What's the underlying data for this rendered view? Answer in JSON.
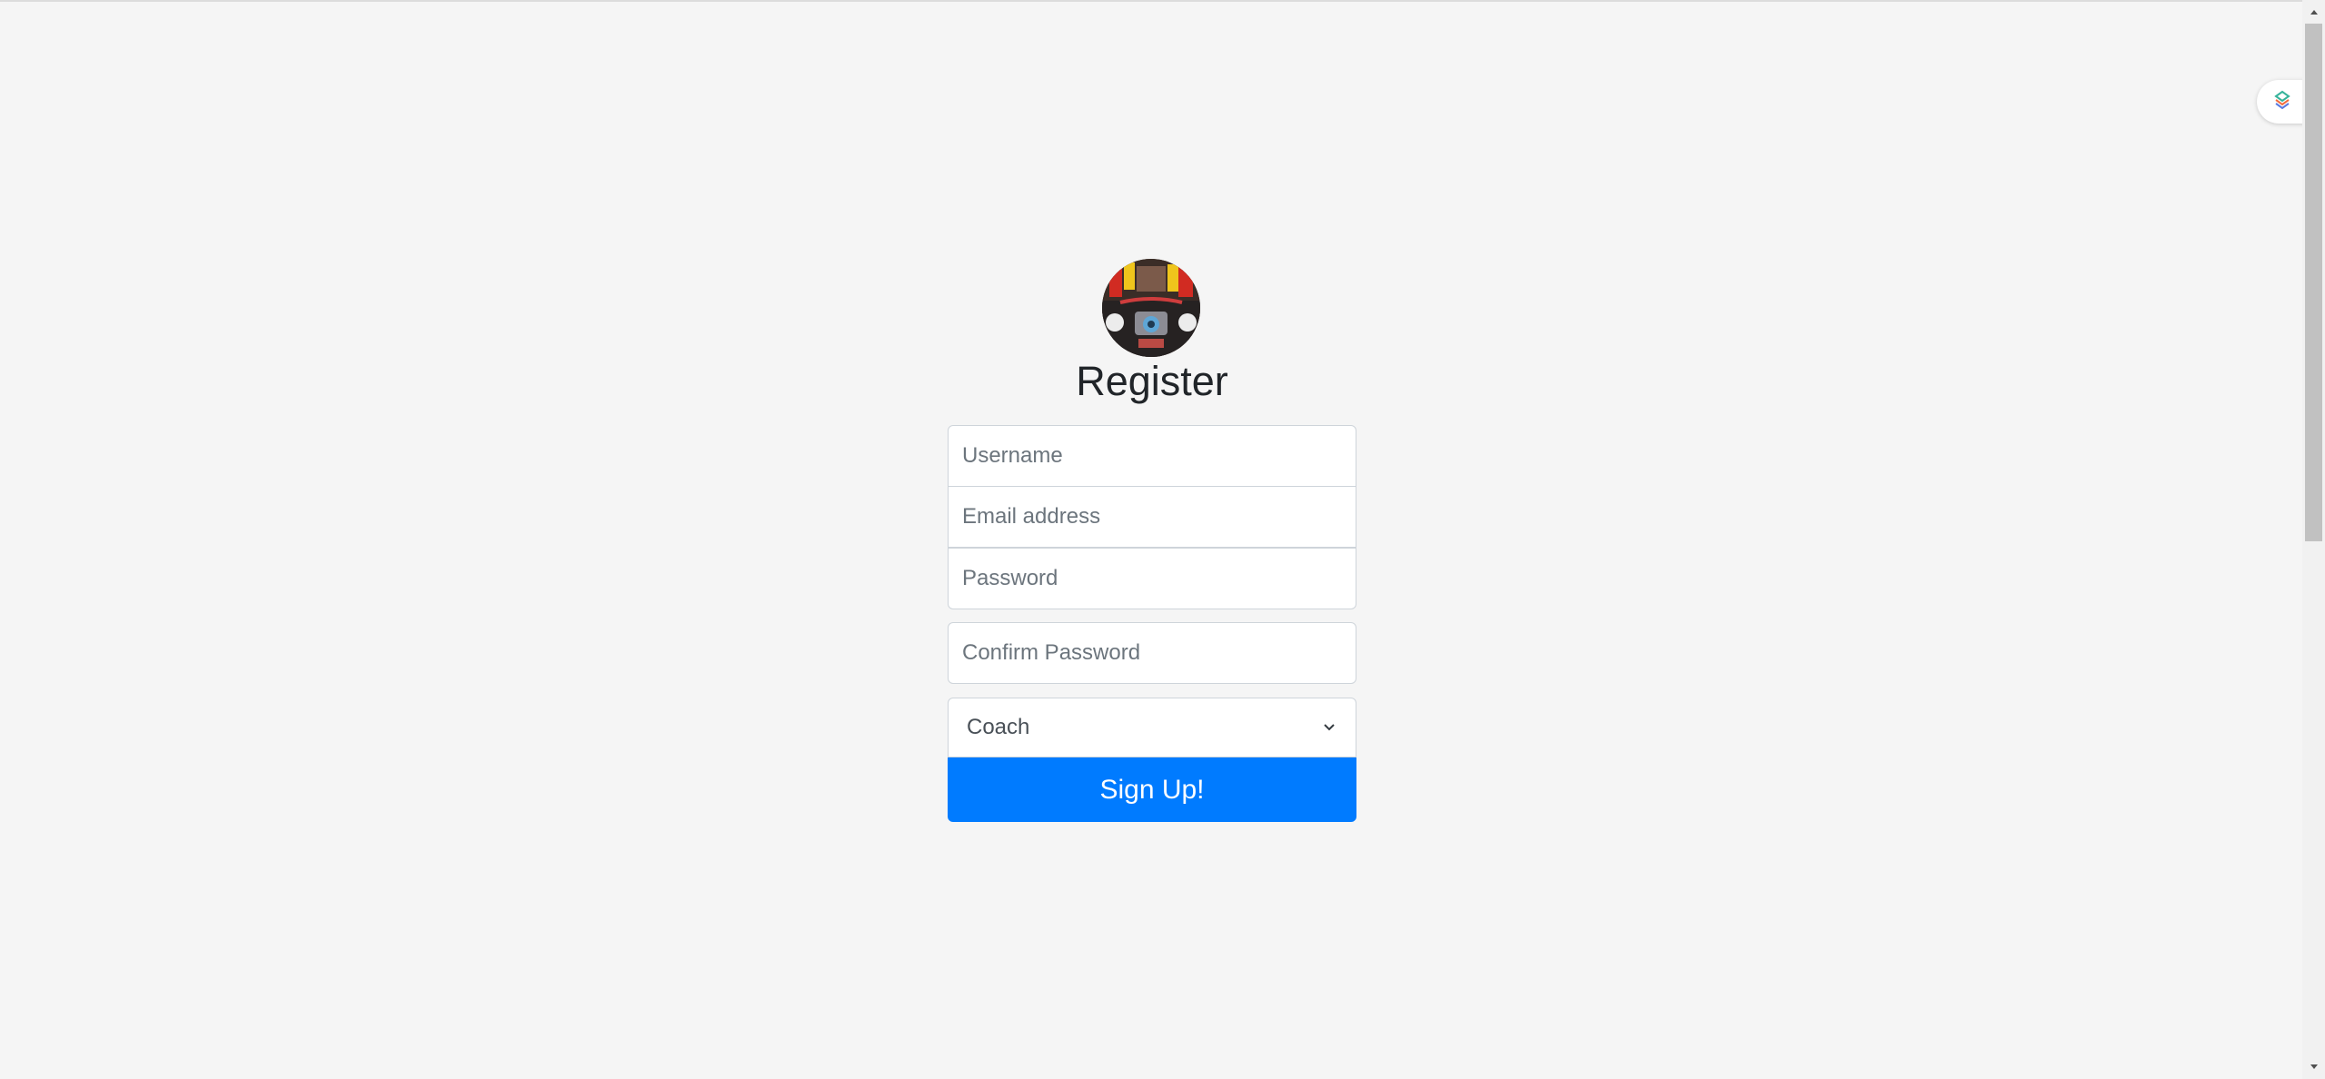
{
  "register": {
    "title": "Register",
    "username_placeholder": "Username",
    "email_placeholder": "Email address",
    "password_placeholder": "Password",
    "confirm_password_placeholder": "Confirm Password",
    "role_select": {
      "selected": "Coach"
    },
    "submit_label": "Sign Up!"
  },
  "colors": {
    "page_background": "#f5f5f5",
    "primary_button": "#007bff",
    "input_border": "#ced4da"
  },
  "icons": {
    "avatar": "avatar-photo",
    "select_arrow": "chevron-down-icon",
    "extension": "extension-badge-icon",
    "scroll_up": "scroll-up-arrow-icon",
    "scroll_down": "scroll-down-arrow-icon"
  }
}
